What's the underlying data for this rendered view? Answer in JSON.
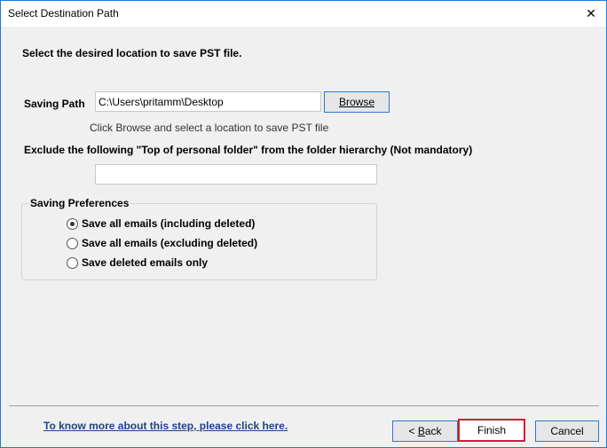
{
  "window": {
    "title": "Select Destination Path",
    "close_glyph": "✕"
  },
  "heading": "Select the desired location to save PST file.",
  "saving_path": {
    "label": "Saving Path",
    "value": "C:\\Users\\pritamm\\Desktop",
    "browse_label": "Browse",
    "hint": "Click Browse and select a location to save PST file"
  },
  "exclude": {
    "label": "Exclude the following \"Top of personal folder\" from the folder hierarchy  (Not mandatory)",
    "value": ""
  },
  "preferences": {
    "title": "Saving Preferences",
    "options": [
      {
        "label": "Save all emails (including deleted)",
        "checked": true
      },
      {
        "label": "Save all emails (excluding deleted)",
        "checked": false
      },
      {
        "label": "Save deleted emails only",
        "checked": false
      }
    ]
  },
  "footer": {
    "help_link": "To know more about this step, please click here.",
    "back_prefix": "< ",
    "back_accel": "B",
    "back_rest": "ack",
    "finish_label": "Finish",
    "cancel_label": "Cancel"
  },
  "colors": {
    "accent": "#2b79d0",
    "highlight": "#d01f2a",
    "link": "#1f3f8f"
  }
}
